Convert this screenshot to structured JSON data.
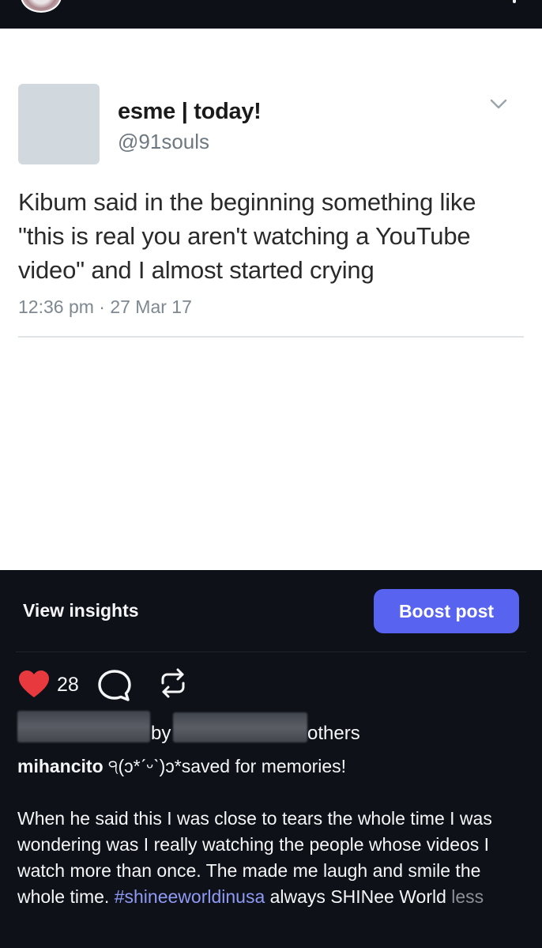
{
  "tweet": {
    "display_name": "esme | today!",
    "handle": "@91souls",
    "text": "Kibum said in the beginning something like \"this is real you aren't watching a YouTube video\" and I almost started crying",
    "timestamp": "12:36 pm · 27 Mar 17"
  },
  "post_actions": {
    "view_insights": "View insights",
    "boost_post": "Boost post"
  },
  "engagement": {
    "like_count": "28",
    "liked_by_word": "by",
    "others_word": "others"
  },
  "caption": {
    "username": "mihancito",
    "text": " ੧(ɔ*ˊᵕˋ)ɔ*saved for memories!"
  },
  "comment": {
    "text": "When he said this I was close to tears the whole time I was wondering was I really watching the people whose videos I watch more than once. The made me laugh and smile the whole time. ",
    "hashtag": "#shineeworldinusa",
    "text_after": "  always SHINee World ",
    "less_label": "less"
  },
  "colors": {
    "accent_button": "#5864f0",
    "like_heart": "#e8393f",
    "hashtag": "#8f9af5",
    "dark_bg": "#0e1117"
  },
  "icons": [
    "heart-icon",
    "comment-icon",
    "repost-icon",
    "chevron-down-icon",
    "more-icon"
  ]
}
